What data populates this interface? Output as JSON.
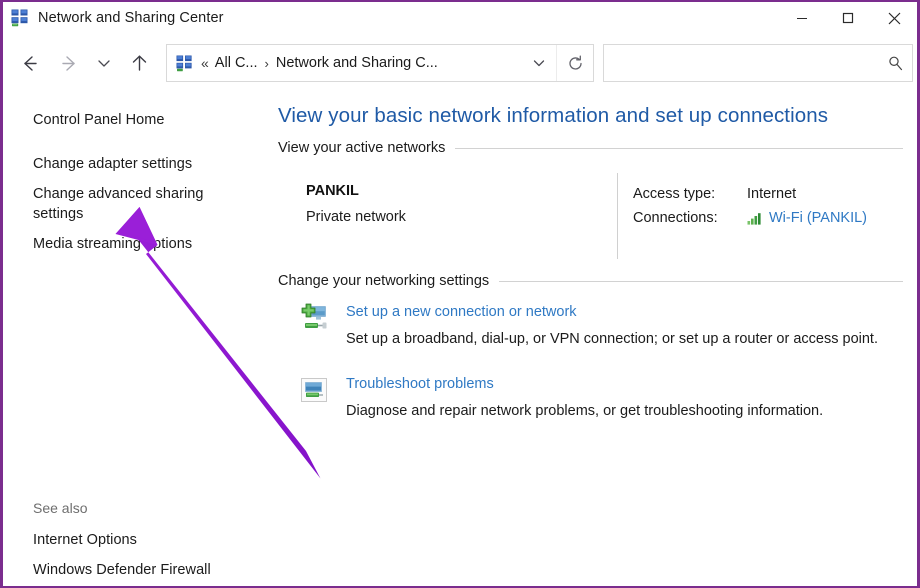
{
  "window": {
    "title": "Network and Sharing Center",
    "title_icon": "network-icon",
    "minimize_label": "—",
    "maximize_label": "□",
    "close_label": "✕",
    "border_color": "#7b2d8e"
  },
  "navbar": {
    "back_icon": "back-arrow-icon",
    "forward_icon": "forward-arrow-icon",
    "recent_icon": "chevron-down-icon",
    "up_icon": "up-arrow-icon",
    "address_icon": "network-icon",
    "breadcrumb_overflow": "«",
    "breadcrumbs": [
      {
        "label": "All C...",
        "separator": "›"
      },
      {
        "label": "Network and Sharing C...",
        "separator": ""
      }
    ],
    "dropdown_icon": "chevron-down-icon",
    "refresh_icon": "refresh-icon",
    "search": {
      "value": "",
      "placeholder": "",
      "icon": "search-icon"
    }
  },
  "sidebar": {
    "items": [
      {
        "label": "Control Panel Home"
      },
      {
        "label": "Change adapter settings"
      },
      {
        "label": "Change advanced sharing settings"
      },
      {
        "label": "Media streaming options"
      }
    ],
    "see_also_label": "See also",
    "see_also_items": [
      {
        "label": "Internet Options"
      },
      {
        "label": "Windows Defender Firewall"
      }
    ]
  },
  "main": {
    "heading": "View your basic network information and set up connections",
    "heading_color": "#1f5aa6",
    "sections": [
      {
        "label": "View your active networks"
      },
      {
        "label": "Change your networking settings"
      }
    ],
    "active_network": {
      "name": "PANKIL",
      "type": "Private network",
      "access_type_key": "Access type:",
      "access_type_value": "Internet",
      "connections_key": "Connections:",
      "connections_icon": "wifi-signal-icon",
      "connections_value": "Wi-Fi (PANKIL)",
      "link_color": "#2f79c4"
    },
    "tasks": [
      {
        "icon": "new-connection-icon",
        "title": "Set up a new connection or network",
        "description": "Set up a broadband, dial-up, or VPN connection; or set up a router or access point."
      },
      {
        "icon": "troubleshoot-icon",
        "title": "Troubleshoot problems",
        "description": "Diagnose and repair network problems, or get troubleshooting information."
      }
    ]
  },
  "annotation": {
    "arrow_color": "#8e16d2",
    "arrow_target": "Change advanced sharing settings"
  }
}
